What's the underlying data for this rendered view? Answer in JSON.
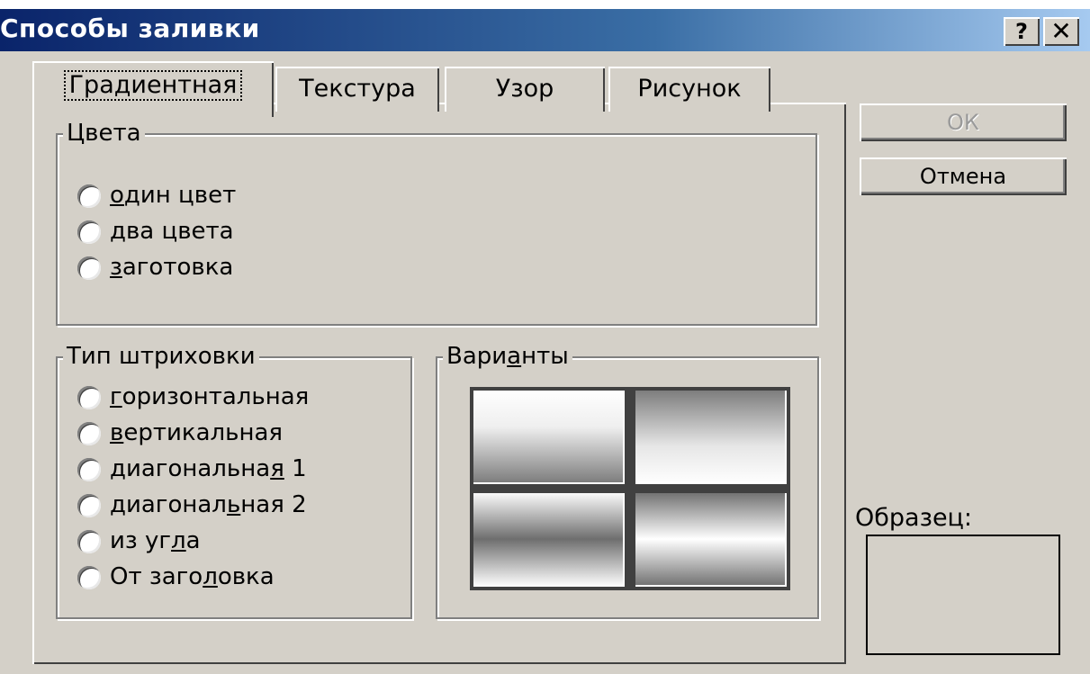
{
  "window": {
    "title": "Способы заливки",
    "help_glyph": "?",
    "close_glyph": "✕"
  },
  "tabs": [
    {
      "label": "Градиентная",
      "active": true
    },
    {
      "label": "Текстура",
      "active": false
    },
    {
      "label": "Узор",
      "active": false
    },
    {
      "label": "Рисунок",
      "active": false
    }
  ],
  "colors_group": {
    "title": "Цвета",
    "options": [
      {
        "hotkey": "о",
        "rest": "дин цвет"
      },
      {
        "hotkey": "д",
        "rest": "ва цвета"
      },
      {
        "hotkey": "з",
        "rest": "аготовка"
      }
    ]
  },
  "hatch_group": {
    "title": "Тип штриховки",
    "options": [
      {
        "pre": "",
        "hotkey": "г",
        "post": "оризонтальная"
      },
      {
        "pre": "",
        "hotkey": "в",
        "post": "ертикальная"
      },
      {
        "pre": "диагональна",
        "hotkey": "я",
        "post": " 1"
      },
      {
        "pre": "диагонал",
        "hotkey": "ь",
        "post": "ная 2"
      },
      {
        "pre": "из уг",
        "hotkey": "л",
        "post": "а"
      },
      {
        "pre": "От заго",
        "hotkey": "л",
        "post": "овка"
      }
    ]
  },
  "variants_group": {
    "title_pre": "Вари",
    "title_hotkey": "а",
    "title_post": "нты"
  },
  "buttons": {
    "ok": "ОК",
    "cancel": "Отмена"
  },
  "sample": {
    "label": "Образец:"
  },
  "colors": {
    "titlebar_start": "#0a246a",
    "titlebar_end": "#a6caf0",
    "face": "#d4d0c8"
  }
}
